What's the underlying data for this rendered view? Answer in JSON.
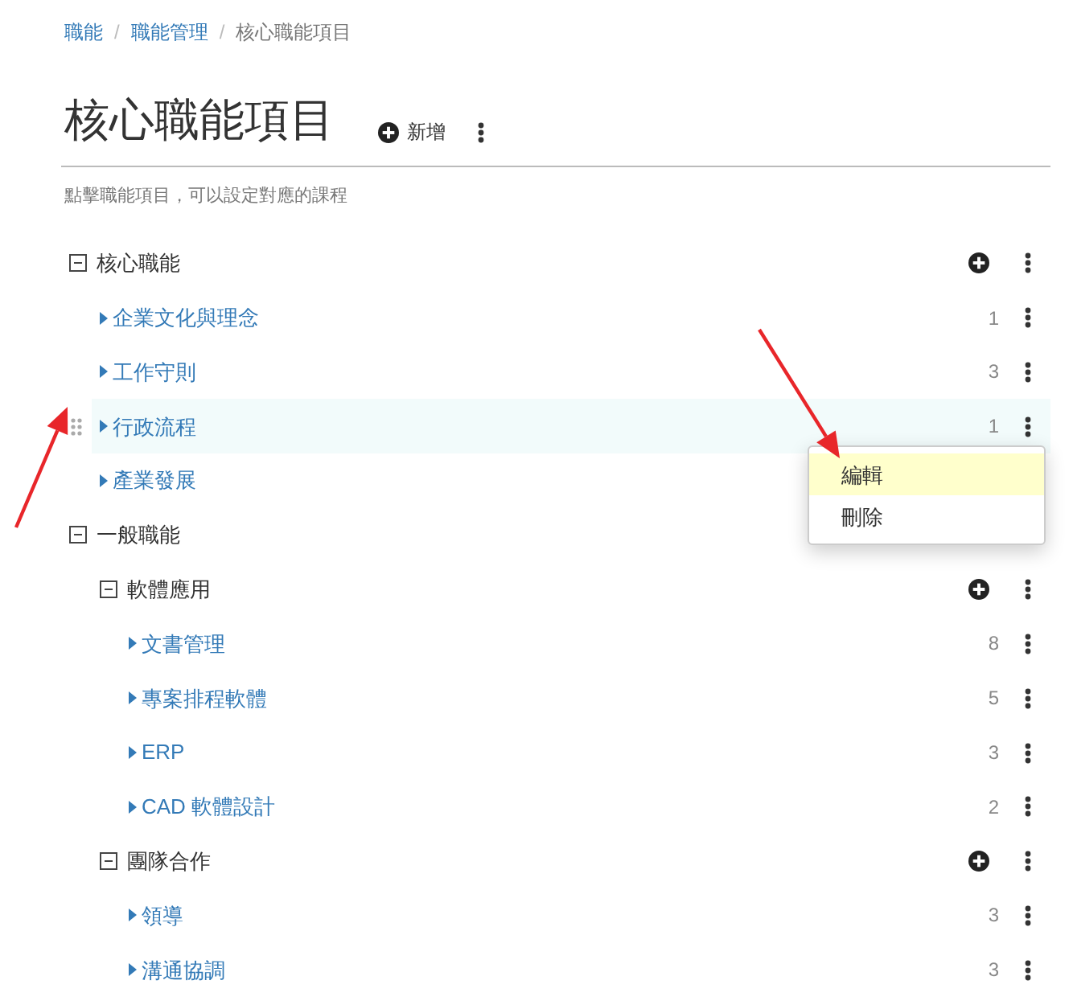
{
  "breadcrumb": [
    {
      "label": "職能",
      "current": false,
      "separator": "/"
    },
    {
      "label": "職能管理",
      "current": false,
      "separator": "/"
    },
    {
      "label": "核心職能項目",
      "current": true
    }
  ],
  "page": {
    "title": "核心職能項目",
    "add_button": "新增",
    "description": "點擊職能項目，可以設定對應的課程"
  },
  "tree": [
    {
      "kind": "group",
      "label": "核心職能",
      "expanded": true,
      "hovered": false,
      "menu_open": false,
      "children": [
        {
          "kind": "item",
          "label": "企業文化與理念",
          "count": "1",
          "expanded": false,
          "hovered": false,
          "menu_open": false
        },
        {
          "kind": "item",
          "label": "工作守則",
          "count": "3",
          "expanded": false,
          "hovered": false,
          "menu_open": false
        },
        {
          "kind": "item",
          "label": "行政流程",
          "count": "1",
          "expanded": false,
          "hovered": true,
          "menu_open": true
        },
        {
          "kind": "item",
          "label": "產業發展",
          "expanded": false,
          "hovered": false,
          "menu_open": false
        }
      ]
    },
    {
      "kind": "group",
      "label": "一般職能",
      "expanded": true,
      "hovered": false,
      "menu_open": false,
      "children": [
        {
          "kind": "group",
          "label": "軟體應用",
          "expanded": true,
          "hovered": false,
          "menu_open": false,
          "children": [
            {
              "kind": "item",
              "label": "文書管理",
              "count": "8",
              "expanded": false,
              "hovered": false,
              "menu_open": false
            },
            {
              "kind": "item",
              "label": "專案排程軟體",
              "count": "5",
              "expanded": false,
              "hovered": false,
              "menu_open": false
            },
            {
              "kind": "item",
              "label": "ERP",
              "count": "3",
              "expanded": false,
              "hovered": false,
              "menu_open": false
            },
            {
              "kind": "item",
              "label": "CAD 軟體設計",
              "count": "2",
              "expanded": false,
              "hovered": false,
              "menu_open": false
            }
          ]
        },
        {
          "kind": "group",
          "label": "團隊合作",
          "expanded": true,
          "hovered": false,
          "menu_open": false,
          "children": [
            {
              "kind": "item",
              "label": "領導",
              "count": "3",
              "expanded": false,
              "hovered": false,
              "menu_open": false
            },
            {
              "kind": "item",
              "label": "溝通協調",
              "count": "3",
              "expanded": false,
              "hovered": false,
              "menu_open": false
            }
          ]
        }
      ]
    }
  ],
  "context_menu": {
    "items": [
      {
        "label": "編輯",
        "selected": true
      },
      {
        "label": "刪除",
        "selected": false
      }
    ]
  },
  "annotations": [
    {
      "kind": "arrow"
    },
    {
      "kind": "arrow"
    }
  ]
}
